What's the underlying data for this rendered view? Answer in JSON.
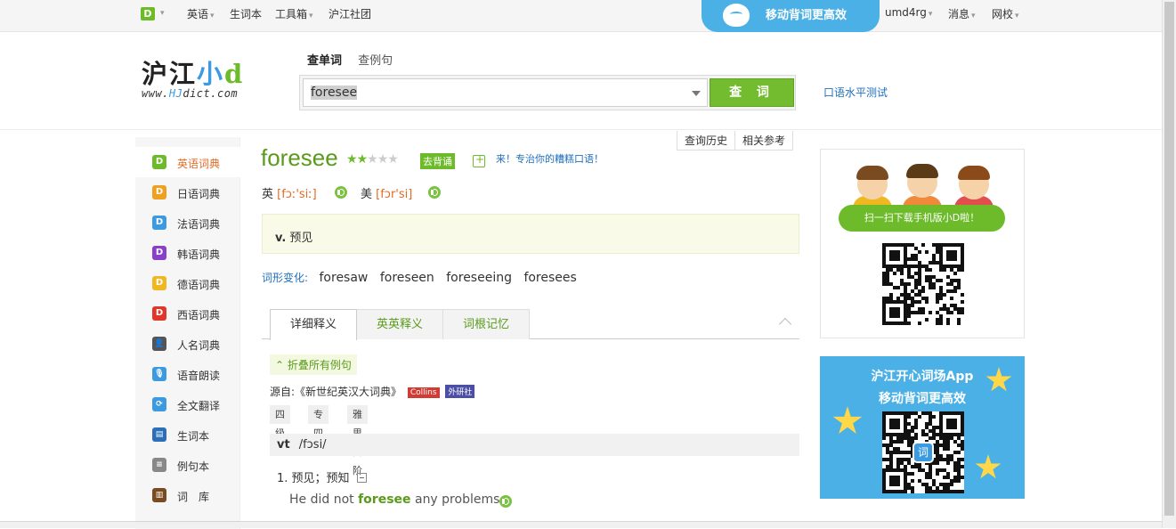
{
  "topbar": {
    "logo": "D",
    "nav": [
      "英语",
      "生词本",
      "工具箱",
      "沪江社团"
    ],
    "promo": "移动背词更高效",
    "user": "umd4rg",
    "messages": "消息",
    "school": "网校"
  },
  "header": {
    "logo_text_1": "沪江",
    "logo_text_2": "小",
    "logo_text_3": "d",
    "logo_url_prefix": "www.",
    "logo_url_hj": "HJ",
    "logo_url_suffix": "dict.com",
    "search_tabs": [
      "查单词",
      "查例句"
    ],
    "search_value": "foresee",
    "search_button": "查 词",
    "oral_test_link": "口语水平测试"
  },
  "sidebar": {
    "items": [
      {
        "label": "英语词典",
        "icon": "D",
        "color": "#6dbb2a"
      },
      {
        "label": "日语词典",
        "icon": "D",
        "color": "#f0a020"
      },
      {
        "label": "法语词典",
        "icon": "D",
        "color": "#3c9be0"
      },
      {
        "label": "韩语词典",
        "icon": "D",
        "color": "#8a3fc8"
      },
      {
        "label": "德语词典",
        "icon": "D",
        "color": "#f0b820"
      },
      {
        "label": "西语词典",
        "icon": "D",
        "color": "#e0372d"
      },
      {
        "label": "人名词典",
        "icon": "person-icon",
        "color": "#555"
      },
      {
        "label": "语音朗读",
        "icon": "microphone-icon",
        "color": "#3c9be0"
      },
      {
        "label": "全文翻译",
        "icon": "translate-icon",
        "color": "#3c9be0"
      },
      {
        "label": "生词本",
        "icon": "book-icon",
        "color": "#2a6fb8"
      },
      {
        "label": "例句本",
        "icon": "notes-icon",
        "color": "#888"
      },
      {
        "label": "词　库",
        "icon": "library-icon",
        "color": "#7a4a20"
      }
    ]
  },
  "entry": {
    "word": "foresee",
    "stars_on": 2,
    "stars_total": 5,
    "recite_tag": "去背诵",
    "promo_text": "来！专治你的糟糕口语！",
    "history_tabs": [
      "查询历史",
      "相关参考"
    ],
    "uk_label": "英",
    "uk_ipa": "[fɔː'siː]",
    "us_label": "美",
    "us_ipa": "[fɔr'si]",
    "short_def_pos": "v.",
    "short_def": "预见",
    "forms_label": "词形变化:",
    "forms": [
      "foresaw",
      "foreseen",
      "foreseeing",
      "foresees"
    ],
    "detail_tabs": [
      "详细释义",
      "英英释义",
      "词根记忆"
    ],
    "fold_button": "折叠所有例句",
    "source_text": "源自:《新世纪英汉大词典》",
    "source_badges": [
      {
        "label": "Collins",
        "color": "#d23b32"
      },
      {
        "label": "外研社",
        "color": "#4b4fa6"
      }
    ],
    "levels": [
      "四级",
      "专四",
      "雅思高阶"
    ],
    "pos": "vt",
    "pos_ipa": "/fɔsi/",
    "sense_num": "1.",
    "sense": "预见；预知",
    "example_pre": "He did not",
    "example_word": "foresee",
    "example_post": "any problems."
  },
  "right": {
    "qr_banner": "扫一扫下载手机版小D啦！",
    "app_title_1": "沪江开心词场App",
    "app_title_2": "移动背词更高效",
    "app_qr_center": "词"
  }
}
